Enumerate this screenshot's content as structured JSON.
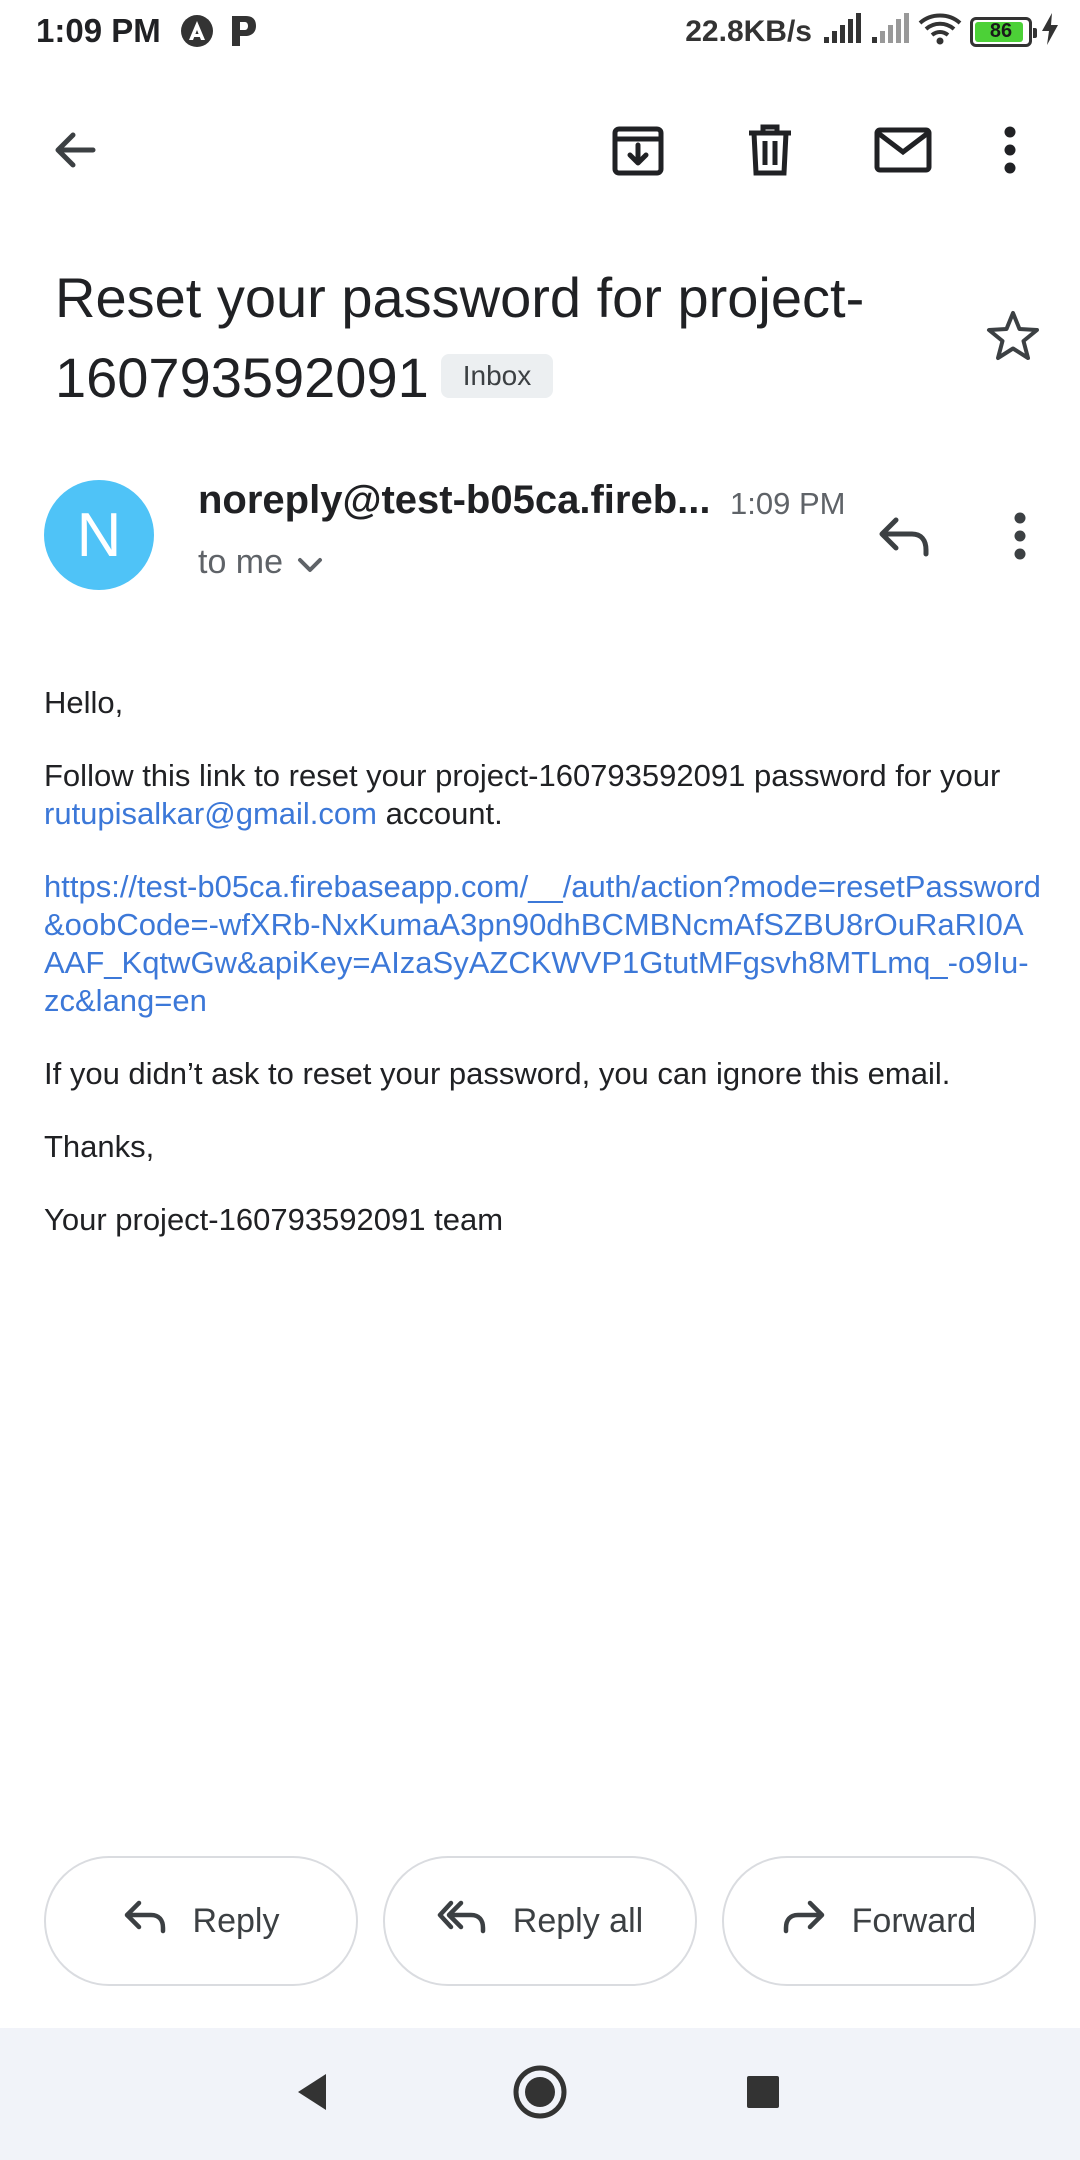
{
  "status_bar": {
    "time": "1:09 PM",
    "network_speed": "22.8KB/s",
    "battery_level": "86",
    "battery_fraction": 0.86,
    "icons": [
      "app-a-icon",
      "app-p-icon",
      "signal-icon",
      "signal-weak-icon",
      "wifi-icon",
      "battery-icon",
      "charging-icon"
    ]
  },
  "toolbar": {
    "icons": [
      "back-arrow-icon",
      "archive-icon",
      "delete-icon",
      "mark-unread-icon",
      "more-vert-icon"
    ]
  },
  "email": {
    "subject": "Reset your password for project-160793592091",
    "label": "Inbox",
    "sender": "noreply@test-b05ca.fireb...",
    "time": "1:09 PM",
    "avatar_initial": "N",
    "avatar_color": "#4fc3f7",
    "recipient": "to me",
    "body": {
      "greeting": "Hello,",
      "instruction_prefix": "Follow this link to reset your project-160793592091 password for your ",
      "account_email": "rutupisalkar@gmail.com",
      "instruction_suffix": " account.",
      "reset_link": "https://test-b05ca.firebaseapp.com/__/auth/action?mode=resetPassword&oobCode=-wfXRb-NxKumaA3pn90dhBCMBNcmAfSZBU8rOuRaRI0AAAF_KqtwGw&apiKey=AIzaSyAZCKWVP1GtutMFgsvh8MTLmq_-o9Iu-zc&lang=en",
      "ignore_note": "If you didn’t ask to reset your password, you can ignore this email.",
      "thanks": "Thanks,",
      "signature": "Your project-160793592091 team"
    }
  },
  "actions": {
    "reply": "Reply",
    "reply_all": "Reply all",
    "forward": "Forward"
  },
  "colors": {
    "link": "#3c78d8",
    "battery_green": "#4cd137",
    "nav_background": "#f1f3f9"
  }
}
